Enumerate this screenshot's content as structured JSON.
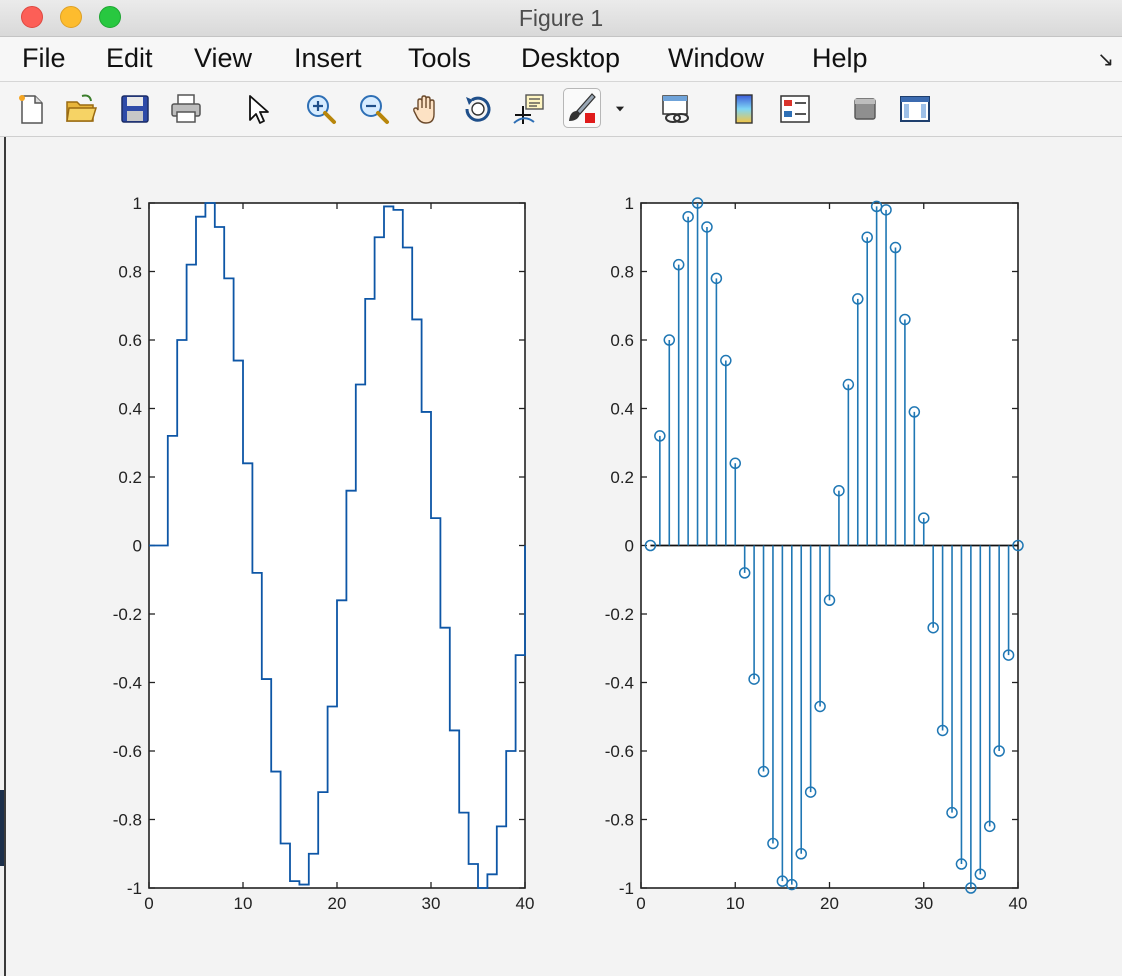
{
  "window": {
    "title": "Figure 1"
  },
  "menu": [
    {
      "id": "file",
      "label": "File"
    },
    {
      "id": "edit",
      "label": "Edit"
    },
    {
      "id": "view",
      "label": "View"
    },
    {
      "id": "insert",
      "label": "Insert"
    },
    {
      "id": "tools",
      "label": "Tools"
    },
    {
      "id": "desktop",
      "label": "Desktop"
    },
    {
      "id": "window",
      "label": "Window"
    },
    {
      "id": "help",
      "label": "Help"
    }
  ],
  "toolbar": [
    "new-figure-icon",
    "open-file-icon",
    "save-icon",
    "print-icon",
    "pointer-arrow-icon",
    "zoom-in-icon",
    "zoom-out-icon",
    "pan-hand-icon",
    "rotate-3d-icon",
    "data-cursor-icon",
    "brush-icon",
    "chevron-down-icon",
    "link-plot-icon",
    "colorbar-icon",
    "legend-icon",
    "hide-plot-tools-icon",
    "show-plot-tools-icon"
  ],
  "colors": {
    "line": "#0d56a6",
    "stem": "#1f77b4",
    "axes": "#222222"
  },
  "chart_data": [
    {
      "type": "line",
      "style": "stairs",
      "x": [
        0,
        1,
        2,
        3,
        4,
        5,
        6,
        7,
        8,
        9,
        10,
        11,
        12,
        13,
        14,
        15,
        16,
        17,
        18,
        19,
        20,
        21,
        22,
        23,
        24,
        25,
        26,
        27,
        28,
        29,
        30,
        31,
        32,
        33,
        34,
        35,
        36,
        37,
        38,
        39,
        40
      ],
      "y": [
        0,
        0,
        0.32,
        0.6,
        0.82,
        0.96,
        1.0,
        0.93,
        0.78,
        0.54,
        0.24,
        -0.08,
        -0.39,
        -0.66,
        -0.87,
        -0.98,
        -0.99,
        -0.9,
        -0.72,
        -0.47,
        -0.16,
        0.16,
        0.47,
        0.72,
        0.9,
        0.99,
        0.98,
        0.87,
        0.66,
        0.39,
        0.08,
        -0.24,
        -0.54,
        -0.78,
        -0.93,
        -1.0,
        -0.96,
        -0.82,
        -0.6,
        -0.32,
        0
      ],
      "xlim": [
        0,
        40
      ],
      "ylim": [
        -1,
        1
      ],
      "xticks": [
        "0",
        "10",
        "20",
        "30",
        "40"
      ],
      "yticks": [
        "1",
        "0.8",
        "0.6",
        "0.4",
        "0.2",
        "0",
        "-0.2",
        "-0.4",
        "-0.6",
        "-0.8",
        "-1"
      ],
      "grid": false
    },
    {
      "type": "stem",
      "x": [
        1,
        2,
        3,
        4,
        5,
        6,
        7,
        8,
        9,
        10,
        11,
        12,
        13,
        14,
        15,
        16,
        17,
        18,
        19,
        20,
        21,
        22,
        23,
        24,
        25,
        26,
        27,
        28,
        29,
        30,
        31,
        32,
        33,
        34,
        35,
        36,
        37,
        38,
        39,
        40
      ],
      "y": [
        0,
        0.32,
        0.6,
        0.82,
        0.96,
        1.0,
        0.93,
        0.78,
        0.54,
        0.24,
        -0.08,
        -0.39,
        -0.66,
        -0.87,
        -0.98,
        -0.99,
        -0.9,
        -0.72,
        -0.47,
        -0.16,
        0.16,
        0.47,
        0.72,
        0.9,
        0.99,
        0.98,
        0.87,
        0.66,
        0.39,
        0.08,
        -0.24,
        -0.54,
        -0.78,
        -0.93,
        -1.0,
        -0.96,
        -0.82,
        -0.6,
        -0.32,
        0
      ],
      "xlim": [
        0,
        40
      ],
      "ylim": [
        -1,
        1
      ],
      "xticks": [
        "0",
        "10",
        "20",
        "30",
        "40"
      ],
      "yticks": [
        "1",
        "0.8",
        "0.6",
        "0.4",
        "0.2",
        "0",
        "-0.2",
        "-0.4",
        "-0.6",
        "-0.8",
        "-1"
      ],
      "grid": false
    }
  ]
}
